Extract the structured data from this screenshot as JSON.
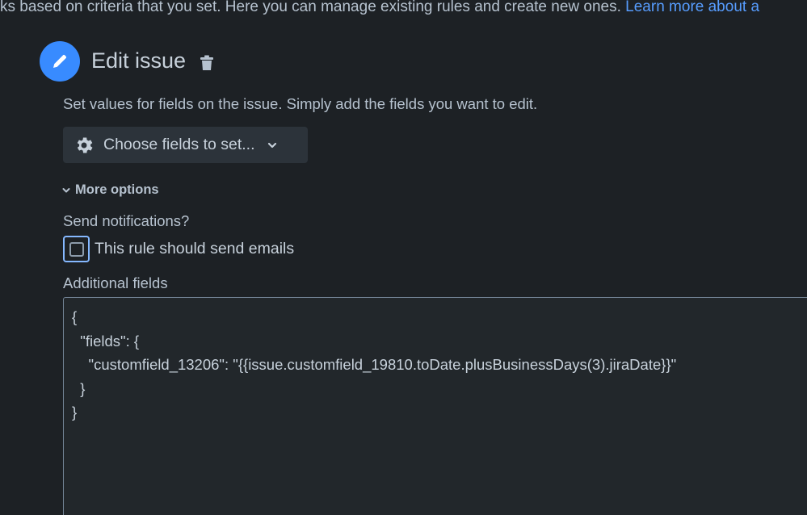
{
  "intro": {
    "text": "ks based on criteria that you set. Here you can manage existing rules and create new ones. ",
    "link": "Learn more about a"
  },
  "action": {
    "title": "Edit issue",
    "icon": "pencil-icon",
    "accent_color": "#388bff",
    "description": "Set values for fields on the issue. Simply add the fields you want to edit."
  },
  "fields_picker": {
    "label": "Choose fields to set..."
  },
  "more_options": {
    "label": "More options"
  },
  "notifications": {
    "label": "Send notifications?",
    "checkbox_label": "This rule should send emails",
    "checked": false
  },
  "additional_fields": {
    "label": "Additional fields",
    "lines": [
      "{",
      "  \"fields\": {",
      "    \"customfield_13206\": \"{{issue.customfield_19810.toDate.plusBusinessDays(3).jiraDate}}\"",
      "  }",
      "}"
    ]
  }
}
